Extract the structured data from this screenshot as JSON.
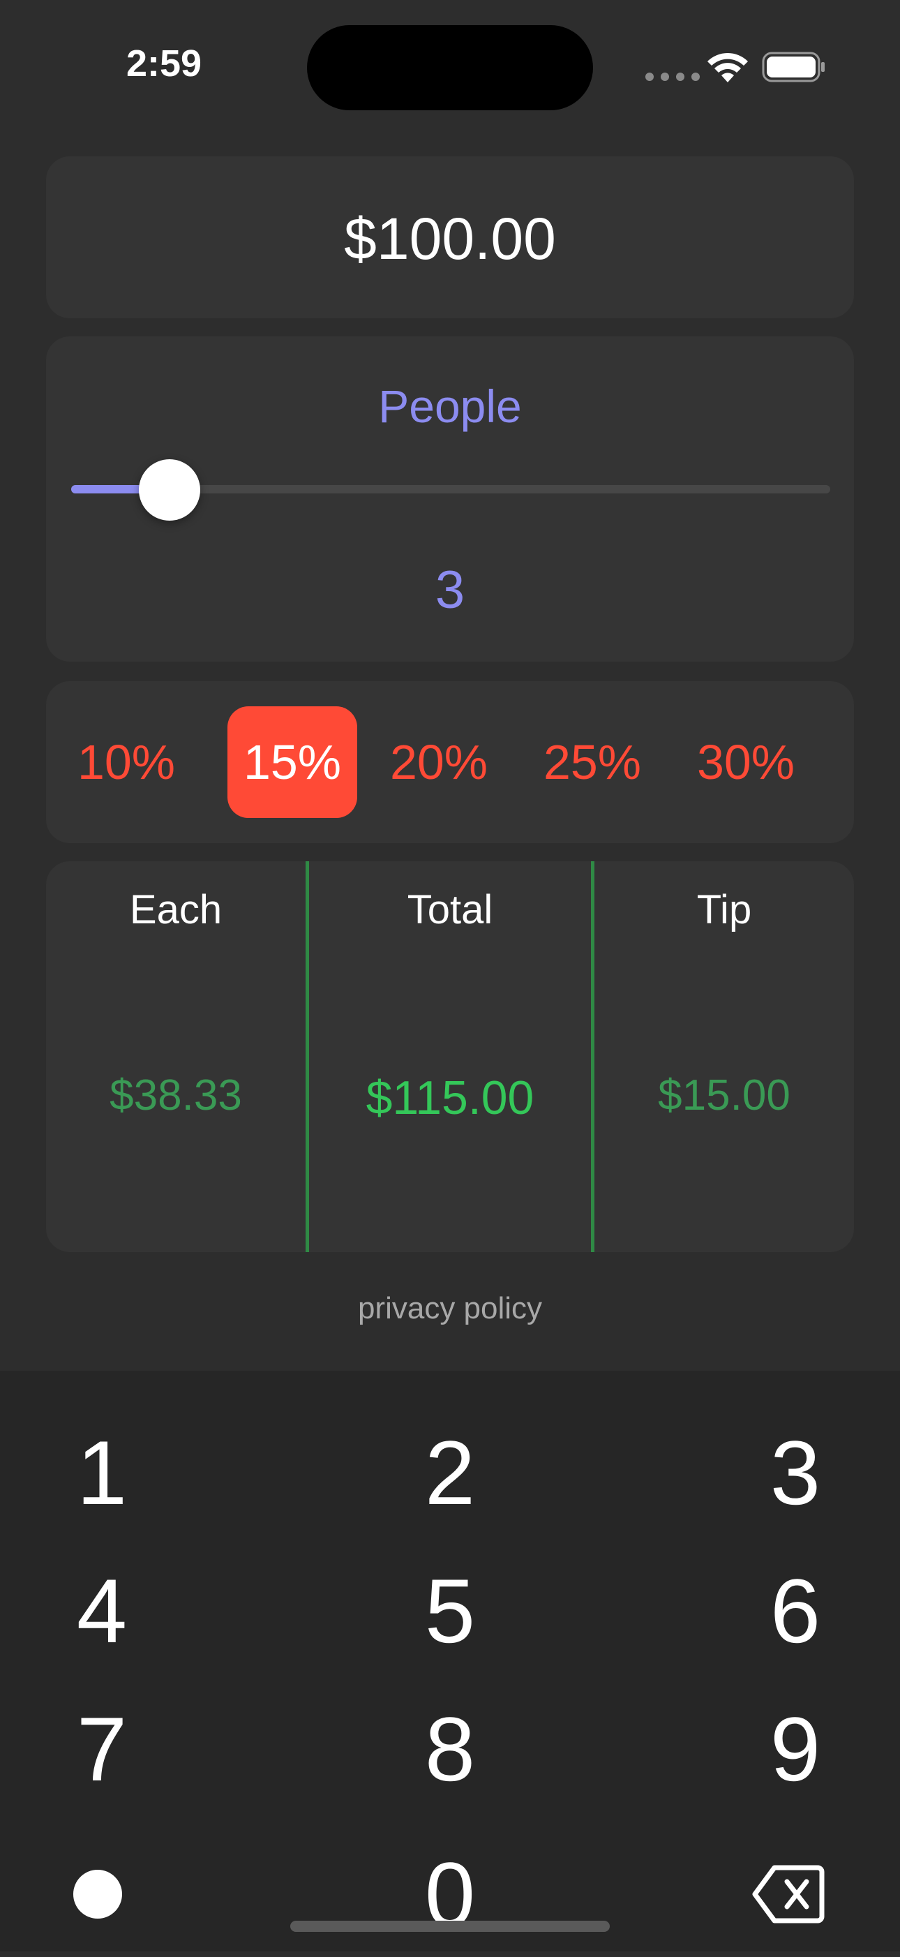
{
  "status_bar": {
    "time": "2:59",
    "wifi_icon": "wifi-icon",
    "battery_icon": "battery-icon"
  },
  "bill": {
    "amount": "$100.00"
  },
  "people": {
    "label": "People",
    "value": "3",
    "slider_fraction": 0.13
  },
  "tips": {
    "options": [
      "10%",
      "15%",
      "20%",
      "25%",
      "30%"
    ],
    "selected": "15%"
  },
  "results": {
    "each": {
      "label": "Each",
      "value": "$38.33"
    },
    "total": {
      "label": "Total",
      "value": "$115.00"
    },
    "tip": {
      "label": "Tip",
      "value": "$15.00"
    }
  },
  "footer": {
    "privacy_link": "privacy policy"
  },
  "keypad": {
    "keys": [
      "1",
      "2",
      "3",
      "4",
      "5",
      "6",
      "7",
      "8",
      "9",
      "0"
    ],
    "decimal_icon": "dot-icon",
    "delete_icon": "backspace-icon"
  },
  "colors": {
    "accent_people": "#8c8cf0",
    "accent_tip": "#ff4a36",
    "accent_result": "#34c759"
  }
}
